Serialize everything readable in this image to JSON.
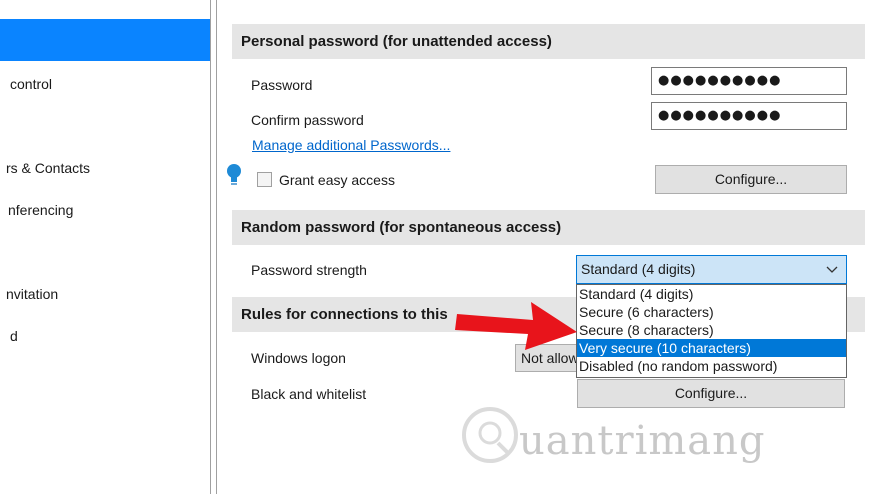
{
  "sidebar": {
    "items": [
      {
        "label": "control"
      },
      {
        "label": "rs & Contacts"
      },
      {
        "label": "nferencing"
      },
      {
        "label": "nvitation"
      },
      {
        "label": "d"
      }
    ]
  },
  "sections": {
    "personal": {
      "header": "Personal password (for unattended access)",
      "password_label": "Password",
      "password_value": "●●●●●●●●●●",
      "confirm_label": "Confirm password",
      "confirm_value": "●●●●●●●●●●",
      "manage_link": "Manage additional Passwords...",
      "grant_label": "Grant easy access",
      "configure_label": "Configure..."
    },
    "random": {
      "header": "Random password (for spontaneous access)",
      "strength_label": "Password strength",
      "strength_selected": "Standard (4 digits)",
      "options": [
        "Standard (4 digits)",
        "Secure (6 characters)",
        "Secure (8 characters)",
        "Very secure (10 characters)",
        "Disabled (no random password)"
      ],
      "highlighted_index": 3
    },
    "rules": {
      "header": "Rules for connections to this",
      "windows_logon_label": "Windows logon",
      "windows_logon_value": "Not allowed",
      "blackwhite_label": "Black and whitelist",
      "configure_label": "Configure..."
    }
  },
  "colors": {
    "accent": "#0a84ff",
    "selection": "#0078d7",
    "arrow": "#e8141b",
    "link": "#0066cc"
  },
  "icons": {
    "bulb": "lightbulb-icon",
    "arrow": "red-arrow-annotation",
    "chevron": "chevron-down-icon"
  },
  "watermark": {
    "text": "uantrimang"
  }
}
